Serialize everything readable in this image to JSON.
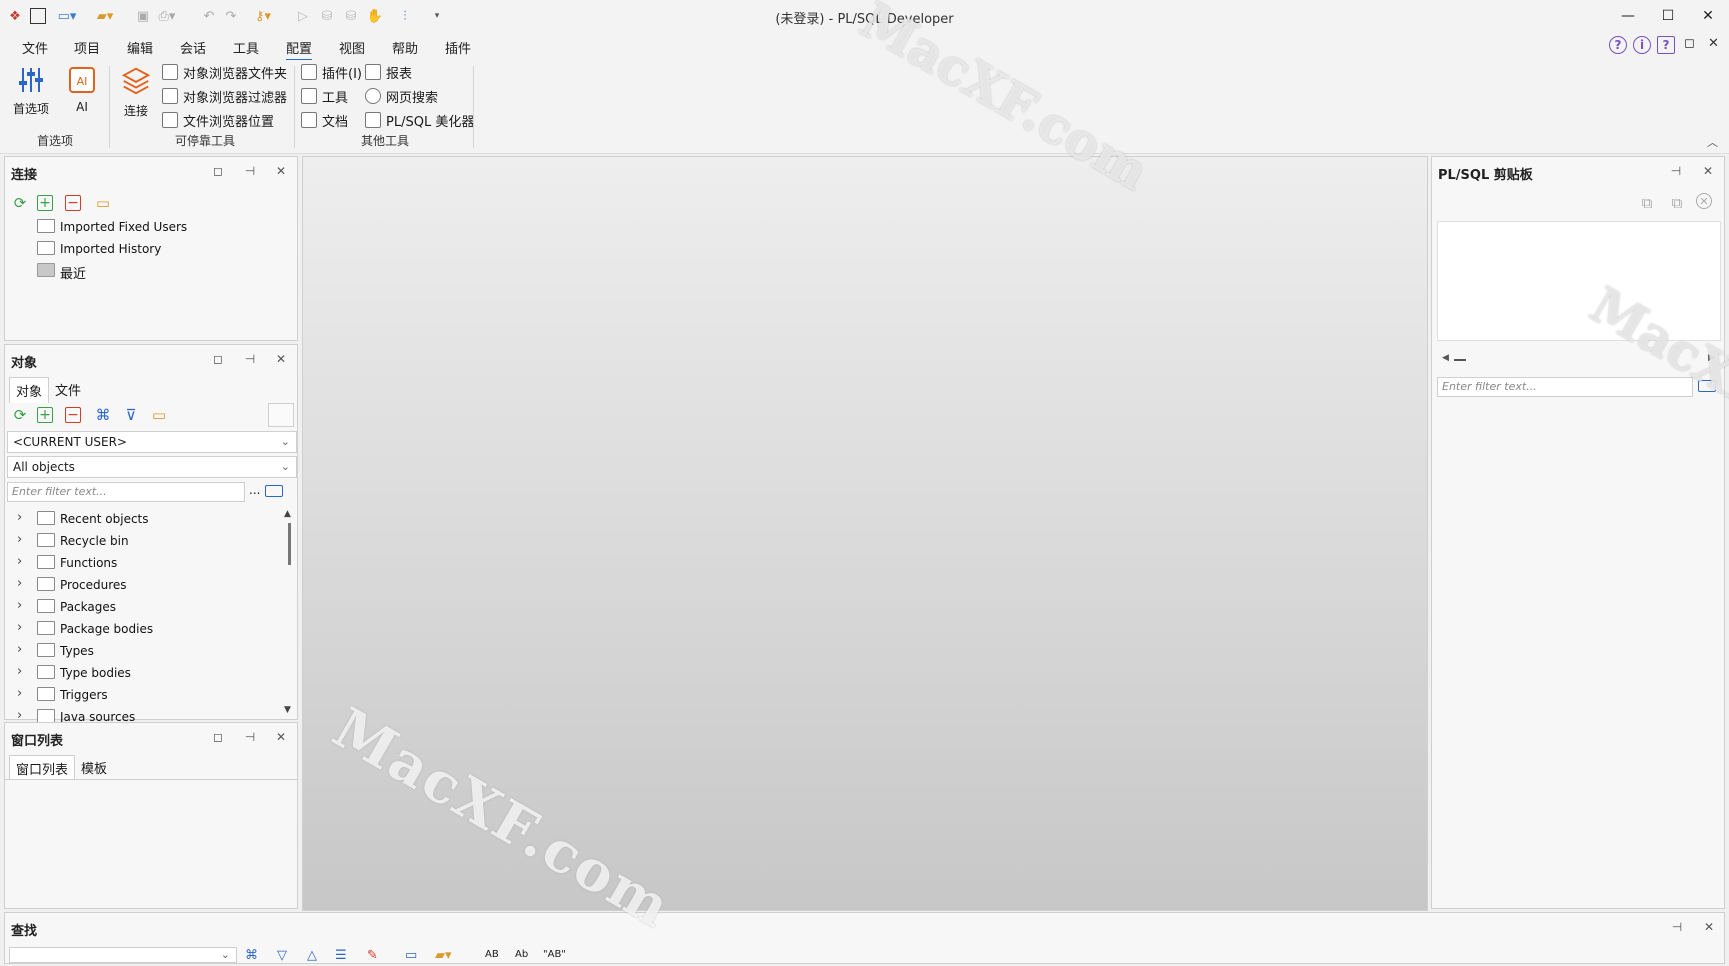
{
  "window": {
    "title": "(未登录) - PL/SQL Developer",
    "minimize": "—",
    "maximize": "☐",
    "close": "✕"
  },
  "menu": {
    "items": [
      "文件",
      "项目",
      "编辑",
      "会话",
      "工具",
      "配置",
      "视图",
      "帮助",
      "插件"
    ],
    "active": "配置"
  },
  "ribbon": {
    "preferences": "首选项",
    "ai": "AI",
    "connect": "连接",
    "obj_browser_folders": "对象浏览器文件夹",
    "obj_browser_filters": "对象浏览器过滤器",
    "file_browser_locations": "文件浏览器位置",
    "plugins": "插件(I)",
    "tools": "工具",
    "documents": "文档",
    "reports": "报表",
    "web_search": "网页搜索",
    "beautifier": "PL/SQL 美化器",
    "group_preferences": "首选项",
    "group_dockable": "可停靠工具",
    "group_other": "其他工具"
  },
  "connections_panel": {
    "title": "连接",
    "items": [
      "Imported Fixed Users",
      "Imported History",
      "最近"
    ]
  },
  "objects_panel": {
    "title": "对象",
    "tabs": [
      "对象",
      "文件"
    ],
    "user_select": "<CURRENT USER>",
    "type_select": "All objects",
    "filter_placeholder": "Enter filter text...",
    "more": "...",
    "tree": [
      "Recent objects",
      "Recycle bin",
      "Functions",
      "Procedures",
      "Packages",
      "Package bodies",
      "Types",
      "Type bodies",
      "Triggers",
      "Java sources"
    ]
  },
  "windowlist_panel": {
    "title": "窗口列表",
    "tabs": [
      "窗口列表",
      "模板"
    ]
  },
  "clipboard_panel": {
    "title": "PL/SQL 剪贴板",
    "filter_placeholder": "Enter filter text..."
  },
  "find_panel": {
    "title": "查找"
  },
  "watermark": "MacXF.com",
  "icons": {
    "help": "?",
    "info": "i",
    "pin": "⊣",
    "close": "✕",
    "restore": "◻"
  },
  "colors": {
    "accent": "#1e6fd0",
    "add": "#3aa04a",
    "remove": "#d23a2a",
    "help": "#7a4fc0"
  }
}
